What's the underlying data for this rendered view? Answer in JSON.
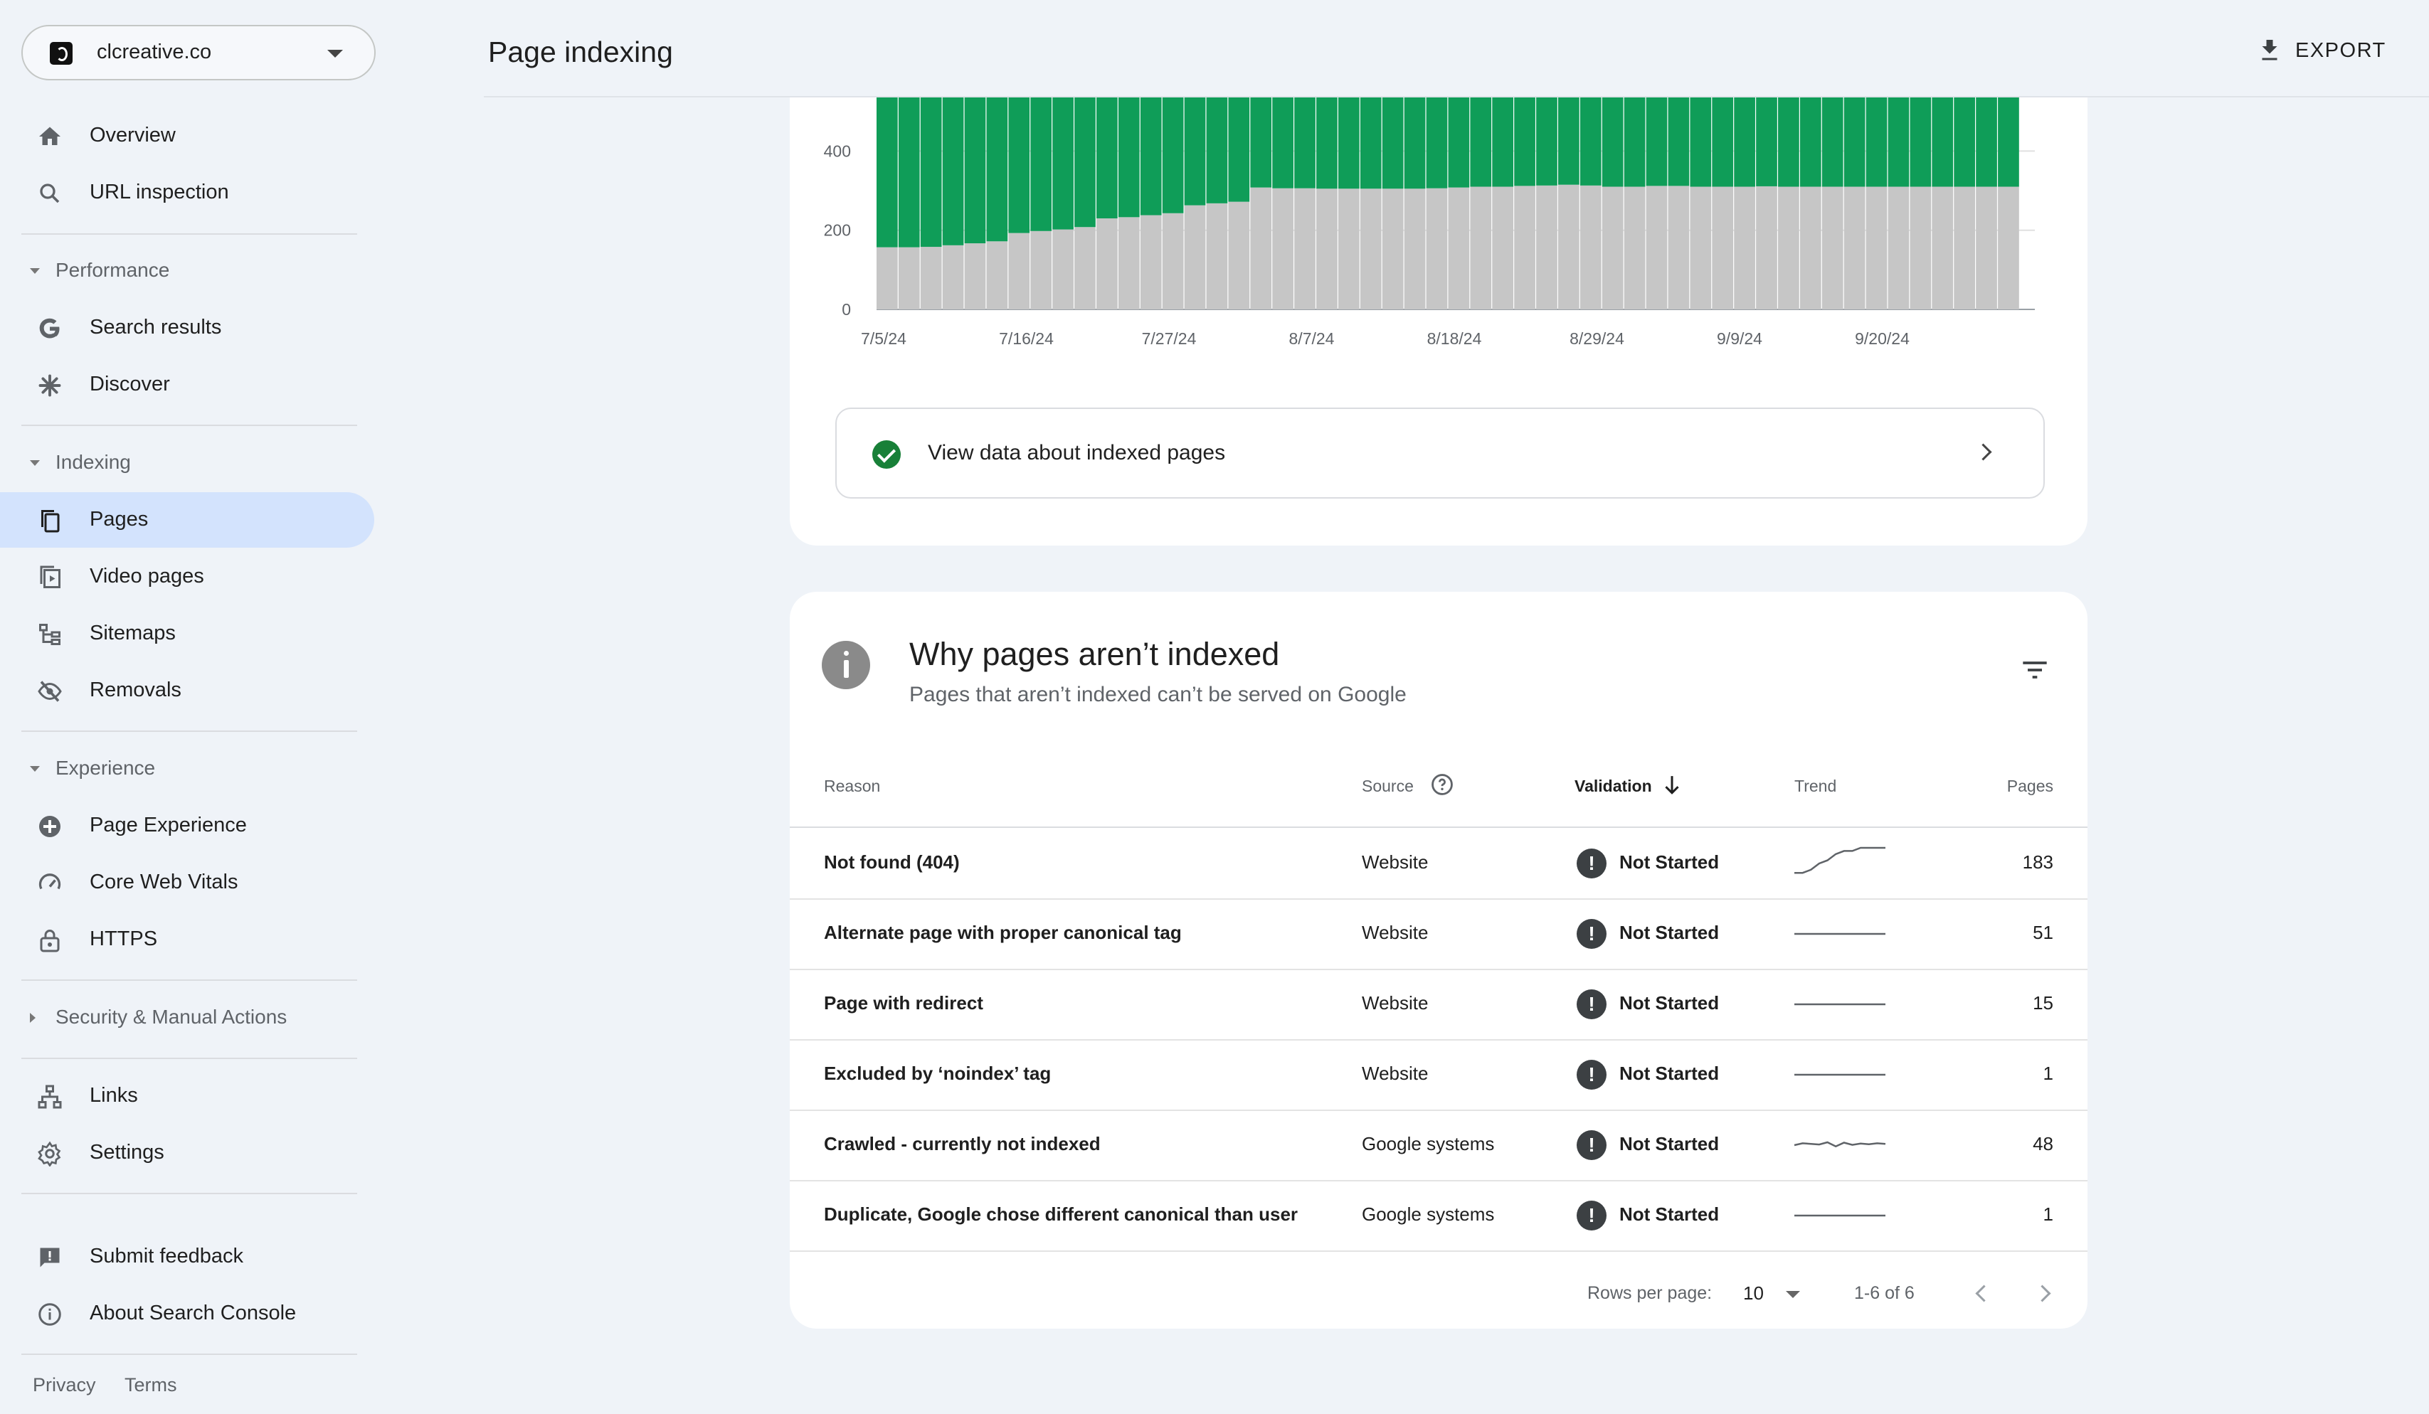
{
  "property": {
    "name": "clcreative.co"
  },
  "sidebar": {
    "top_items": [
      {
        "label": "Overview",
        "icon": "home-icon"
      },
      {
        "label": "URL inspection",
        "icon": "search-icon"
      }
    ],
    "sections": [
      {
        "title": "Performance",
        "items": [
          {
            "label": "Search results",
            "icon": "google-g-icon"
          },
          {
            "label": "Discover",
            "icon": "asterisk-icon"
          }
        ]
      },
      {
        "title": "Indexing",
        "items": [
          {
            "label": "Pages",
            "icon": "pages-icon",
            "active": true
          },
          {
            "label": "Video pages",
            "icon": "video-pages-icon"
          },
          {
            "label": "Sitemaps",
            "icon": "sitemap-icon"
          },
          {
            "label": "Removals",
            "icon": "eye-off-icon"
          }
        ]
      },
      {
        "title": "Experience",
        "items": [
          {
            "label": "Page Experience",
            "icon": "plus-circle-icon"
          },
          {
            "label": "Core Web Vitals",
            "icon": "gauge-icon"
          },
          {
            "label": "HTTPS",
            "icon": "lock-icon"
          }
        ]
      },
      {
        "title": "Security & Manual Actions",
        "collapsed": true
      }
    ],
    "bottom_items": [
      {
        "label": "Links",
        "icon": "links-icon"
      },
      {
        "label": "Settings",
        "icon": "gear-icon"
      }
    ],
    "feedback_items": [
      {
        "label": "Submit feedback",
        "icon": "feedback-icon"
      },
      {
        "label": "About Search Console",
        "icon": "info-icon"
      }
    ],
    "footer": {
      "privacy": "Privacy",
      "terms": "Terms"
    }
  },
  "header": {
    "title": "Page indexing",
    "export_label": "EXPORT"
  },
  "chart_data": {
    "type": "bar",
    "stacked": true,
    "x_tick_labels": [
      "7/5/24",
      "7/16/24",
      "7/27/24",
      "8/7/24",
      "8/18/24",
      "8/29/24",
      "9/9/24",
      "9/20/24"
    ],
    "y_ticks": [
      0,
      200,
      400
    ],
    "ylim": [
      0,
      535
    ],
    "colors": {
      "not_indexed": "#c6c6c6",
      "indexed": "#0f9d58"
    },
    "series": [
      {
        "key": "not_indexed",
        "values": [
          157,
          157,
          158,
          162,
          167,
          172,
          193,
          198,
          202,
          208,
          230,
          233,
          238,
          243,
          263,
          268,
          272,
          308,
          306,
          306,
          305,
          305,
          305,
          305,
          305,
          306,
          308,
          310,
          310,
          312,
          313,
          315,
          313,
          310,
          310,
          312,
          312,
          310,
          310,
          310,
          311,
          310,
          310,
          310,
          310,
          310,
          310,
          310,
          310,
          310,
          310,
          310
        ]
      },
      {
        "key": "indexed",
        "values": [
          380,
          380,
          379,
          375,
          370,
          365,
          344,
          339,
          335,
          329,
          307,
          304,
          299,
          294,
          274,
          269,
          265,
          229,
          231,
          231,
          232,
          232,
          232,
          232,
          232,
          231,
          229,
          227,
          227,
          225,
          224,
          222,
          224,
          227,
          227,
          225,
          225,
          227,
          227,
          227,
          226,
          227,
          227,
          227,
          227,
          227,
          227,
          227,
          227,
          227,
          227,
          227
        ]
      }
    ]
  },
  "view_data": {
    "label": "View data about indexed pages"
  },
  "why_not_indexed": {
    "title": "Why pages aren’t indexed",
    "subtitle": "Pages that aren’t indexed can’t be served on Google",
    "columns": {
      "reason": "Reason",
      "source": "Source",
      "validation": "Validation",
      "trend": "Trend",
      "pages": "Pages"
    },
    "rows": [
      {
        "reason": "Not found (404)",
        "source": "Website",
        "validation": "Not Started",
        "pages": "183",
        "trend": [
          2,
          2,
          3,
          5,
          6,
          8,
          9,
          9,
          10,
          10,
          10,
          10
        ]
      },
      {
        "reason": "Alternate page with proper canonical tag",
        "source": "Website",
        "validation": "Not Started",
        "pages": "51",
        "trend": [
          5,
          5,
          5,
          5,
          5,
          5,
          5,
          5,
          5,
          5,
          5,
          5
        ]
      },
      {
        "reason": "Page with redirect",
        "source": "Website",
        "validation": "Not Started",
        "pages": "15",
        "trend": [
          5,
          5,
          5,
          5,
          5,
          5,
          5,
          5,
          5,
          5,
          5,
          5
        ]
      },
      {
        "reason": "Excluded by ‘noindex’ tag",
        "source": "Website",
        "validation": "Not Started",
        "pages": "1",
        "trend": [
          5,
          5,
          5,
          5,
          5,
          5,
          5,
          5,
          5,
          5,
          5,
          5
        ]
      },
      {
        "reason": "Crawled - currently not indexed",
        "source": "Google systems",
        "validation": "Not Started",
        "pages": "48",
        "trend": [
          5,
          5.6,
          5.4,
          5.2,
          5.9,
          4.6,
          5.8,
          5.1,
          5.5,
          5.3,
          5.6,
          5.4
        ]
      },
      {
        "reason": "Duplicate, Google chose different canonical than user",
        "source": "Google systems",
        "validation": "Not Started",
        "pages": "1",
        "trend": [
          5,
          5,
          5,
          5,
          5,
          5,
          5,
          5,
          5,
          5,
          5,
          5
        ]
      }
    ],
    "pagination": {
      "rows_label": "Rows per page:",
      "rows_value": "10",
      "range": "1-6 of 6"
    }
  }
}
